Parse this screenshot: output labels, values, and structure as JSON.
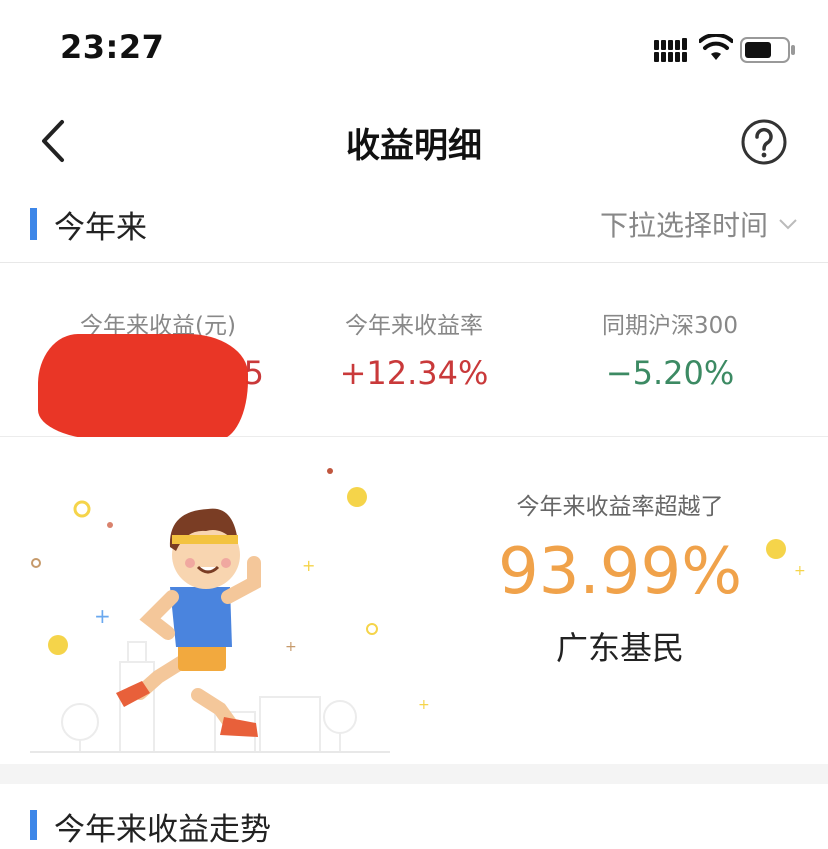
{
  "status_bar": {
    "time": "23:27"
  },
  "nav": {
    "title": "收益明细"
  },
  "section": {
    "title": "今年来",
    "time_picker": "下拉选择时间"
  },
  "stats": [
    {
      "label": "今年来收益(元)",
      "value": "5"
    },
    {
      "label": "今年来收益率",
      "value": "+12.34%",
      "color": "#c9393a"
    },
    {
      "label": "同期沪深300",
      "value": "−5.20%",
      "color": "#3c8a63"
    }
  ],
  "promo": {
    "label": "今年来收益率超越了",
    "percent": "93.99%",
    "group": "广东基民"
  },
  "section2": {
    "title": "今年来收益走势"
  },
  "colors": {
    "accent": "#3d86e8",
    "orange": "#f0a24a",
    "redaction": "#e8301f"
  }
}
